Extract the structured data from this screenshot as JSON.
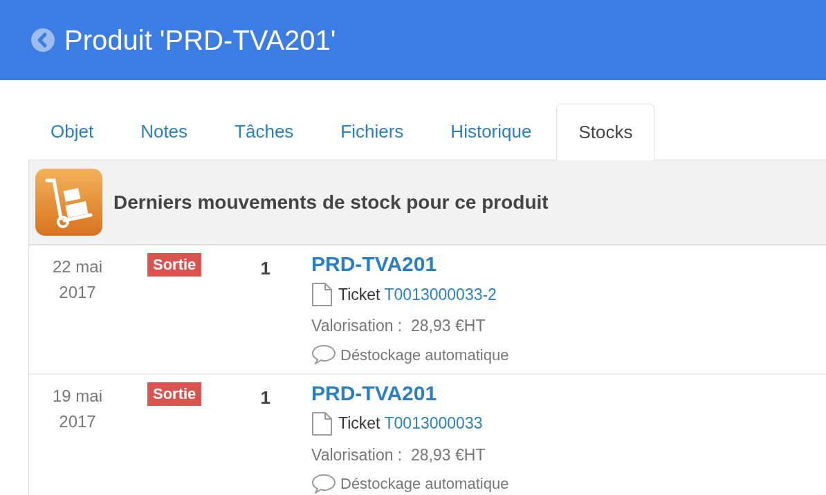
{
  "header": {
    "title": "Produit 'PRD-TVA201'"
  },
  "tabs": [
    {
      "label": "Objet",
      "selected": false
    },
    {
      "label": "Notes",
      "selected": false
    },
    {
      "label": "Tâches",
      "selected": false
    },
    {
      "label": "Fichiers",
      "selected": false
    },
    {
      "label": "Historique",
      "selected": false
    },
    {
      "label": "Stocks",
      "selected": true
    }
  ],
  "section": {
    "title": "Derniers mouvements de stock pour ce produit"
  },
  "movements": [
    {
      "date": "22 mai 2017",
      "type": "Sortie",
      "quantity": "1",
      "product": "PRD-TVA201",
      "document_label": "Ticket",
      "document_ref": "T0013000033-2",
      "valuation": "Valorisation :  28,93 €HT",
      "comment": "Déstockage automatique"
    },
    {
      "date": "19 mai 2017",
      "type": "Sortie",
      "quantity": "1",
      "product": "PRD-TVA201",
      "document_label": "Ticket",
      "document_ref": "T0013000033",
      "valuation": "Valorisation :  28,93 €HT",
      "comment": "Déstockage automatique"
    }
  ]
}
